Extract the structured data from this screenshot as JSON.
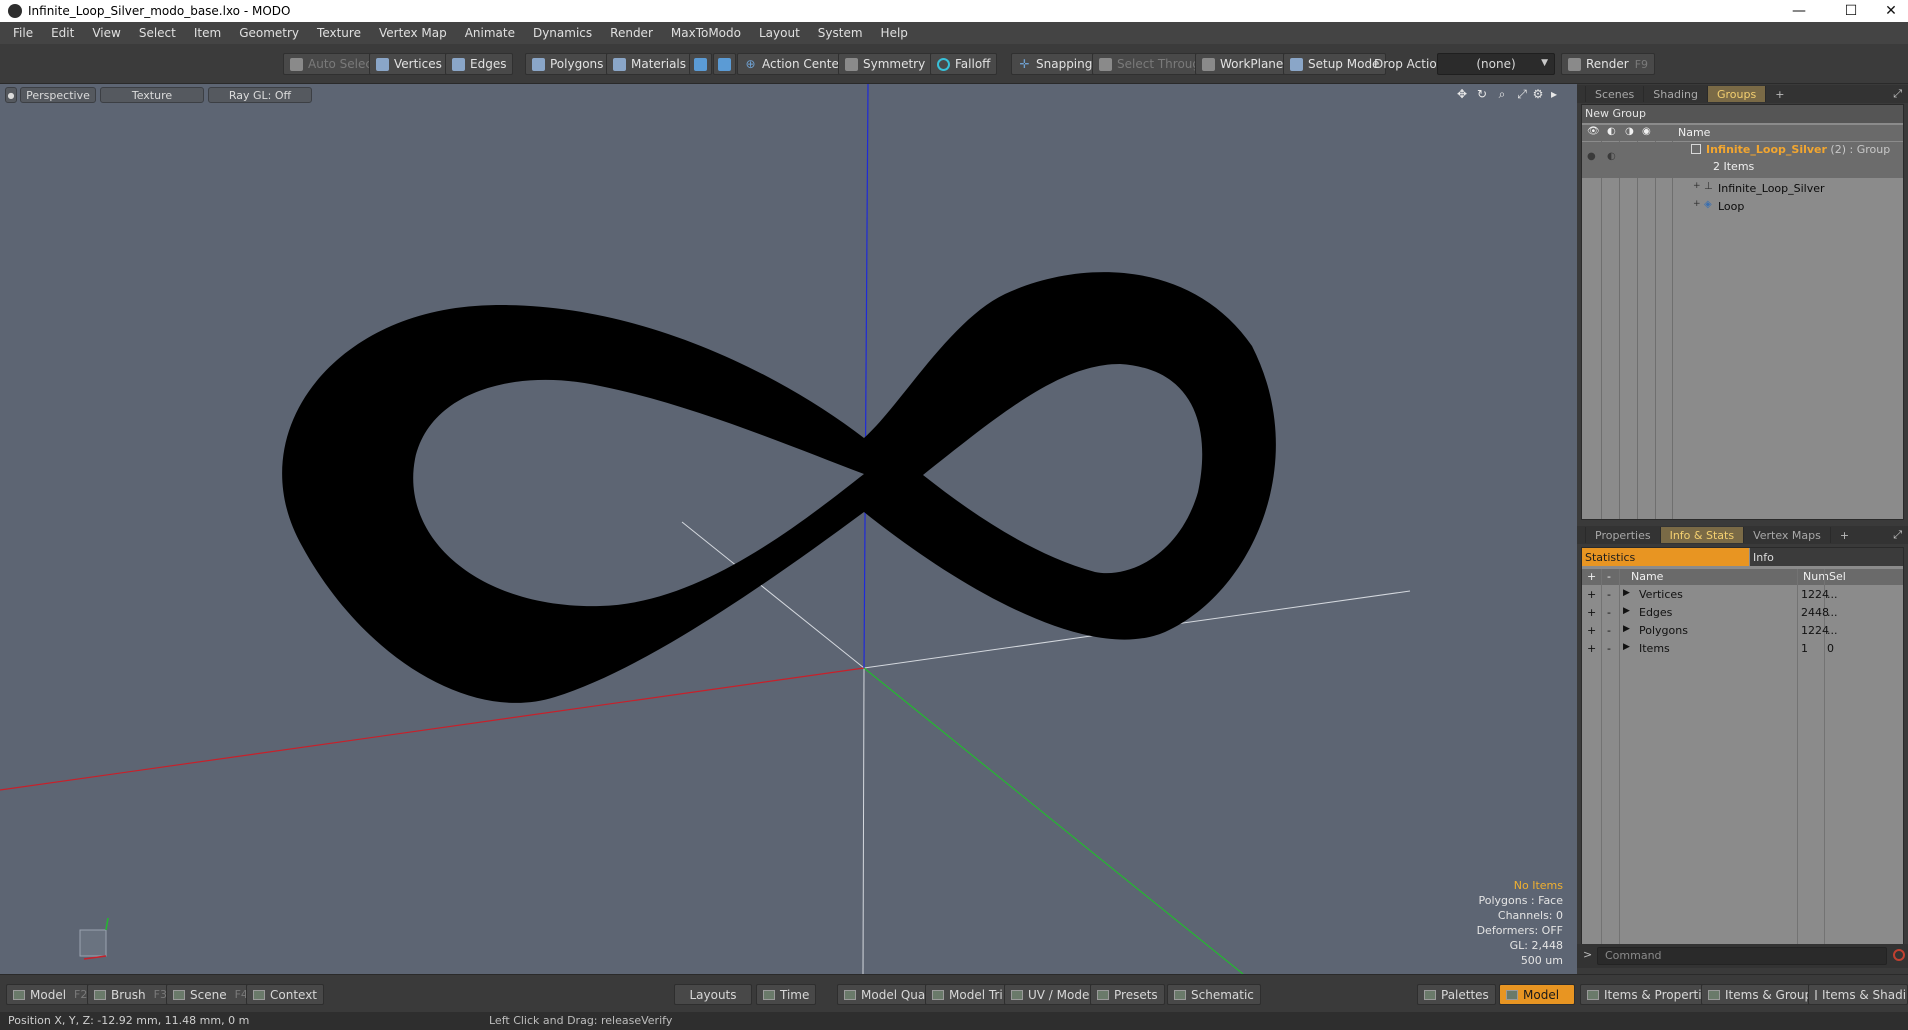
{
  "window": {
    "title": "Infinite_Loop_Silver_modo_base.lxo - MODO",
    "min_glyph": "—",
    "max_glyph": "☐",
    "close_glyph": "✕"
  },
  "menu": [
    "File",
    "Edit",
    "View",
    "Select",
    "Item",
    "Geometry",
    "Texture",
    "Vertex Map",
    "Animate",
    "Dynamics",
    "Render",
    "MaxToModo",
    "Layout",
    "System",
    "Help"
  ],
  "toolbar": {
    "auto_select": "Auto Select",
    "vertices": "Vertices",
    "edges": "Edges",
    "polygons": "Polygons",
    "materials": "Materials",
    "action_center": "Action Center",
    "symmetry": "Symmetry",
    "falloff": "Falloff",
    "snapping": "Snapping",
    "select_through": "Select Through",
    "workplane": "WorkPlane",
    "setup_mode": "Setup Mode",
    "drop_action_label": "Drop Action",
    "drop_action_value": "(none)",
    "render": "Render",
    "render_key": "F9"
  },
  "viewport": {
    "tabs": [
      "Perspective",
      "Texture",
      "Ray GL: Off"
    ],
    "overlay": {
      "no_items": "No Items",
      "polygons": "Polygons : Face",
      "channels": "Channels: 0",
      "deformers": "Deformers: OFF",
      "gl": "GL: 2,448",
      "scale": "500 um"
    },
    "axis_colors": {
      "x": "#c8202a",
      "y": "#1e2ad8",
      "z": "#24b830",
      "grid": "#d4d8de"
    },
    "mesh_color": "#000000",
    "background": "#5d6573"
  },
  "scenes_panel": {
    "tabs": [
      "Scenes",
      "Shading",
      "Groups"
    ],
    "active_tab": "Groups",
    "new_group": "New Group",
    "name_header": "Name",
    "group_name": "Infinite_Loop_Silver",
    "group_suffix": " (2) : Group",
    "items_count": "2 Items",
    "children": [
      "Infinite_Loop_Silver",
      "Loop"
    ]
  },
  "info_panel": {
    "tabs": [
      "Properties",
      "Info & Stats",
      "Vertex Maps"
    ],
    "active_tab": "Info & Stats",
    "sub_tabs": [
      "Statistics",
      "Info"
    ],
    "columns": {
      "name": "Name",
      "num": "Num",
      "sel": "Sel"
    },
    "rows": [
      {
        "name": "Vertices",
        "num": "1224",
        "sel": "..."
      },
      {
        "name": "Edges",
        "num": "2448",
        "sel": "..."
      },
      {
        "name": "Polygons",
        "num": "1224",
        "sel": "..."
      },
      {
        "name": "Items",
        "num": "1",
        "sel": "0"
      }
    ]
  },
  "command": {
    "placeholder": "Command"
  },
  "bottom": {
    "model": "Model",
    "model_key": "F2",
    "brush": "Brush",
    "brush_key": "F3",
    "scene": "Scene",
    "scene_key": "F4",
    "context": "Context",
    "layouts": "Layouts",
    "time": "Time",
    "model_quad": "Model Quad",
    "model_tri": "Model Tri",
    "uv_model": "UV / Model",
    "presets": "Presets",
    "schematic": "Schematic",
    "palettes": "Palettes",
    "model_active": "Model",
    "items_properties": "Items & Properties",
    "items_groups": "Items & Groups",
    "items_shading": "Items & Shading"
  },
  "status": {
    "position": "Position X, Y, Z:   -12.92 mm, 11.48 mm, 0 m",
    "hint": "Left Click and Drag:   releaseVerify"
  }
}
